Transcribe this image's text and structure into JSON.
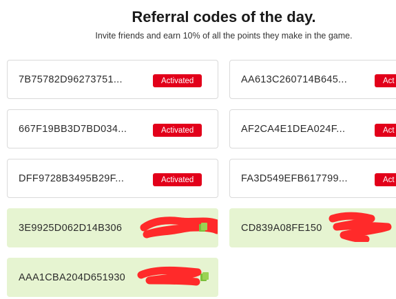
{
  "header": {
    "title": "Referral codes of the day.",
    "subtitle": "Invite friends and earn 10% of all the points they make in the game."
  },
  "codes": [
    {
      "code": "7B75782D96273751...",
      "status": "Activated"
    },
    {
      "code": "AA613C260714B645...",
      "status": "Act"
    },
    {
      "code": "667F19BB3D7BD034...",
      "status": "Activated"
    },
    {
      "code": "AF2CA4E1DEA024F...",
      "status": "Act"
    },
    {
      "code": "DFF9728B3495B29F...",
      "status": "Activated"
    },
    {
      "code": "FA3D549EFB617799...",
      "status": "Act"
    },
    {
      "code": "3E9925D062D14B306"
    },
    {
      "code": "CD839A08FE150"
    },
    {
      "code": "AAA1CBA204D651930"
    }
  ],
  "colors": {
    "activated_badge": "#e2001a",
    "available_card": "#e6f4d1",
    "copy_icon": "#9ad253",
    "redaction": "#ff2a2a"
  },
  "icons": {
    "copy": "copy-icon"
  }
}
